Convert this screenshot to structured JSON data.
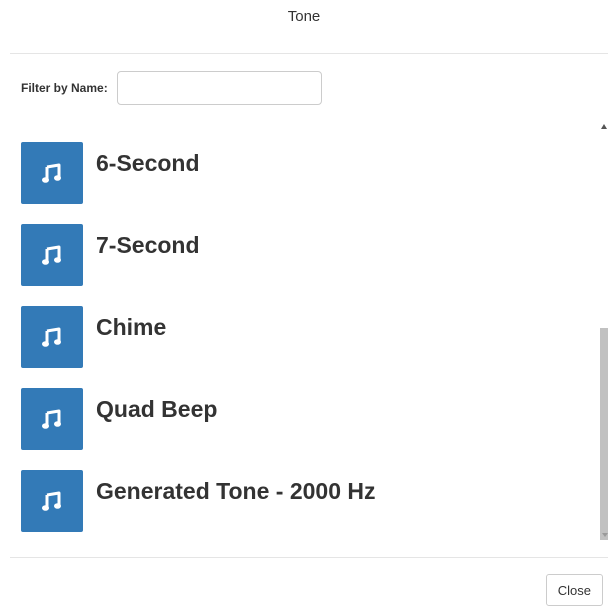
{
  "dialog": {
    "title": "Tone"
  },
  "filter": {
    "label": "Filter by Name:",
    "value": "",
    "placeholder": ""
  },
  "tones": {
    "items": [
      {
        "label": "6-Second",
        "icon": "music-note-icon"
      },
      {
        "label": "7-Second",
        "icon": "music-note-icon"
      },
      {
        "label": "Chime",
        "icon": "music-note-icon"
      },
      {
        "label": "Quad Beep",
        "icon": "music-note-icon"
      },
      {
        "label": "Generated Tone - 2000 Hz",
        "icon": "music-note-icon"
      }
    ]
  },
  "footer": {
    "close_label": "Close"
  },
  "colors": {
    "accent": "#337ab7",
    "text": "#333333",
    "border": "#cccccc"
  }
}
